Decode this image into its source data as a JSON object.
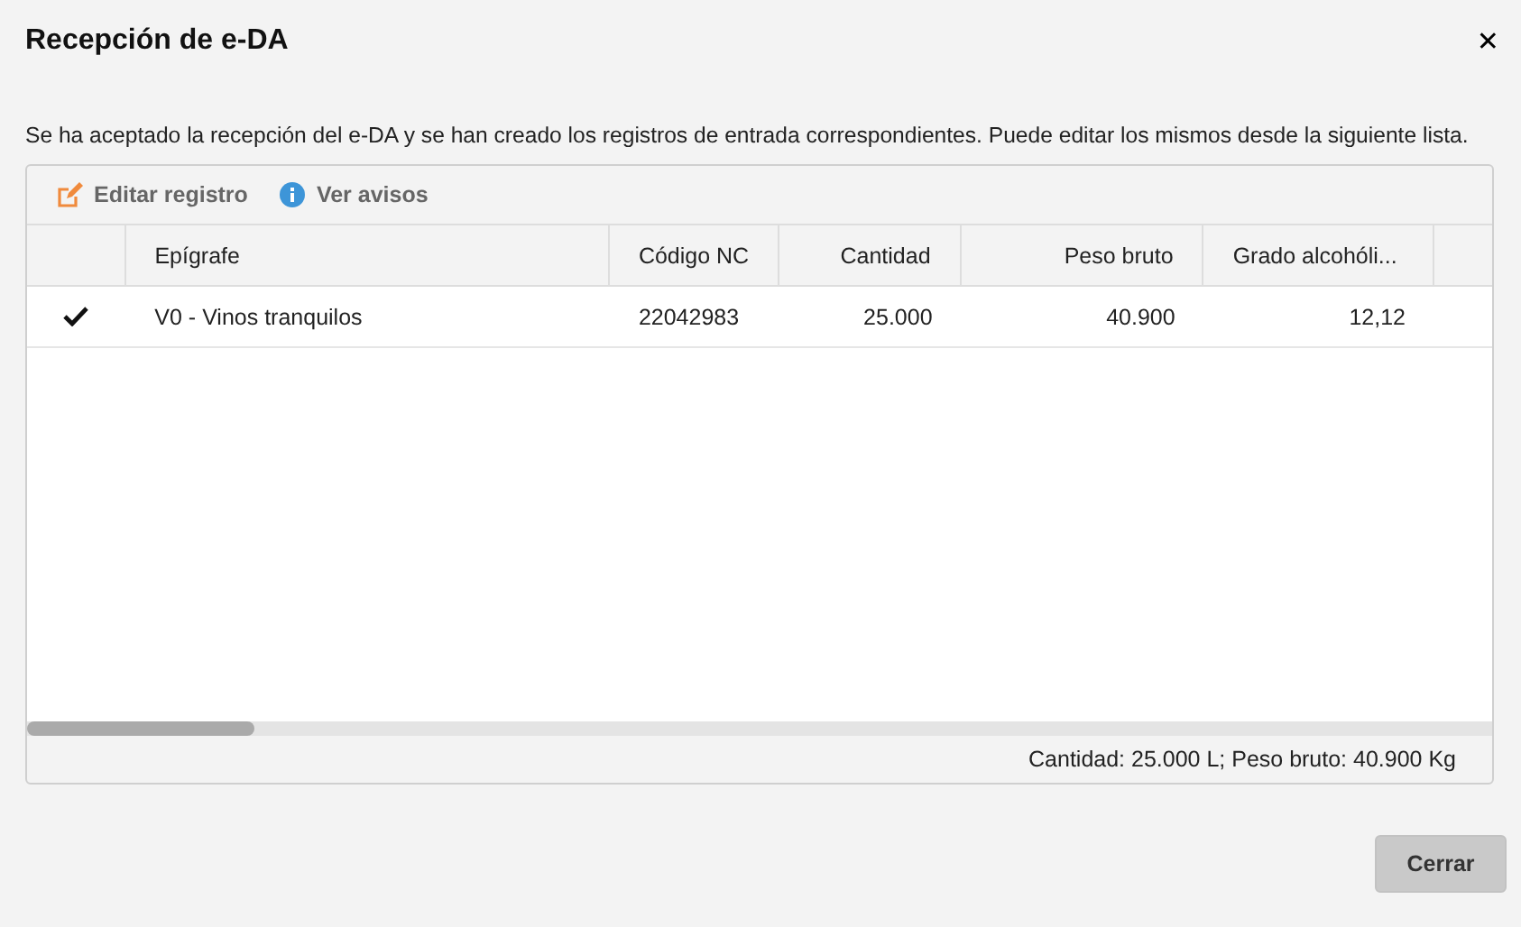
{
  "window": {
    "title": "Recepción de e-DA",
    "close": "✕"
  },
  "message": "Se ha aceptado la recepción del e-DA y se han creado los registros de entrada correspondientes. Puede editar los mismos desde la siguiente lista.",
  "toolbar": [
    {
      "kind": "edit",
      "label": "Editar registro"
    },
    {
      "kind": "info",
      "label": "Ver avisos"
    }
  ],
  "table": {
    "columns": [
      "Epígrafe",
      "Código NC",
      "Cantidad",
      "Peso bruto",
      "Grado alcohóli..."
    ],
    "rows": [
      {
        "checked": true,
        "cells": [
          "V0 - Vinos tranquilos",
          "22042983",
          "25.000",
          "40.900",
          "12,12"
        ]
      }
    ]
  },
  "summary": "Cantidad: 25.000 L; Peso bruto: 40.900 Kg",
  "buttons": [
    "Cerrar"
  ]
}
